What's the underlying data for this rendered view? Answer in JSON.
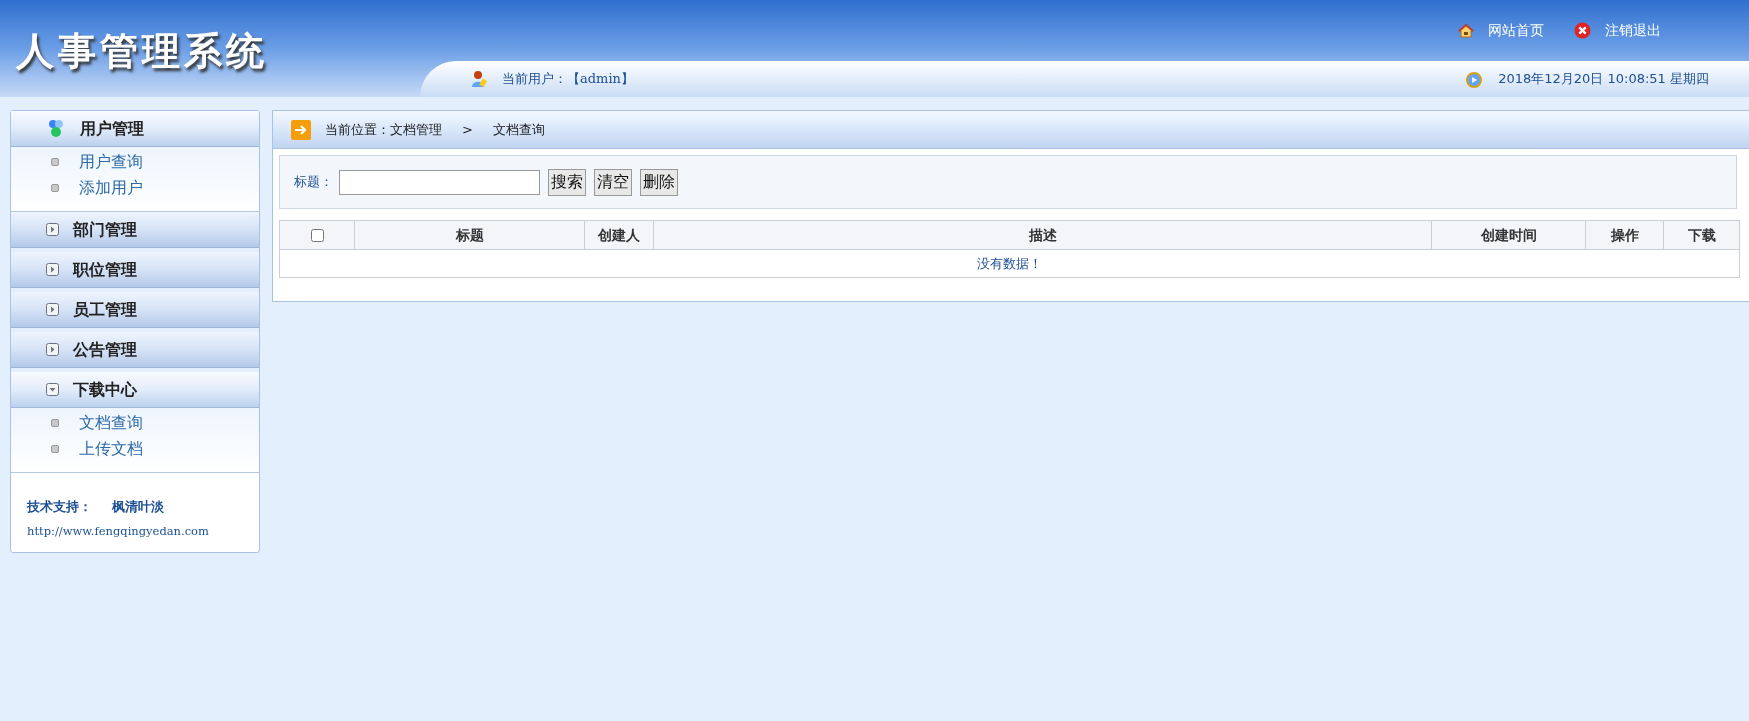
{
  "header": {
    "logo": "人事管理系统",
    "links": [
      {
        "kind": "home",
        "label": "网站首页"
      },
      {
        "kind": "logout",
        "label": "注销退出"
      }
    ],
    "current_user_label": "当前用户：",
    "current_user": "【admin】",
    "datetime": "2018年12月20日 10:08:51 星期四"
  },
  "sidebar": {
    "groups": [
      {
        "kind": "users",
        "title": "用户管理",
        "expanded": true,
        "items": [
          {
            "label": "用户查询"
          },
          {
            "label": "添加用户"
          }
        ]
      },
      {
        "kind": "plain",
        "title": "部门管理",
        "expanded": false
      },
      {
        "kind": "plain",
        "title": "职位管理",
        "expanded": false
      },
      {
        "kind": "plain",
        "title": "员工管理",
        "expanded": false
      },
      {
        "kind": "plain",
        "title": "公告管理",
        "expanded": false
      },
      {
        "kind": "plain",
        "title": "下载中心",
        "expanded": true,
        "items": [
          {
            "label": "文档查询"
          },
          {
            "label": "上传文档"
          }
        ]
      }
    ],
    "support_label": "技术支持：",
    "support_name": "枫清叶淡",
    "support_url": "http://www.fengqingyedan.com"
  },
  "breadcrumb": {
    "label": "当前位置：",
    "path": [
      "文档管理",
      "文档查询"
    ],
    "separator": ">"
  },
  "search": {
    "label": "标题：",
    "buttons": [
      "搜索",
      "清空",
      "删除"
    ]
  },
  "table": {
    "select_all": {
      "checked": false
    },
    "columns": [
      "标题",
      "创建人",
      "描述",
      "创建时间",
      "操作",
      "下载"
    ],
    "empty_message": "没有数据！"
  }
}
